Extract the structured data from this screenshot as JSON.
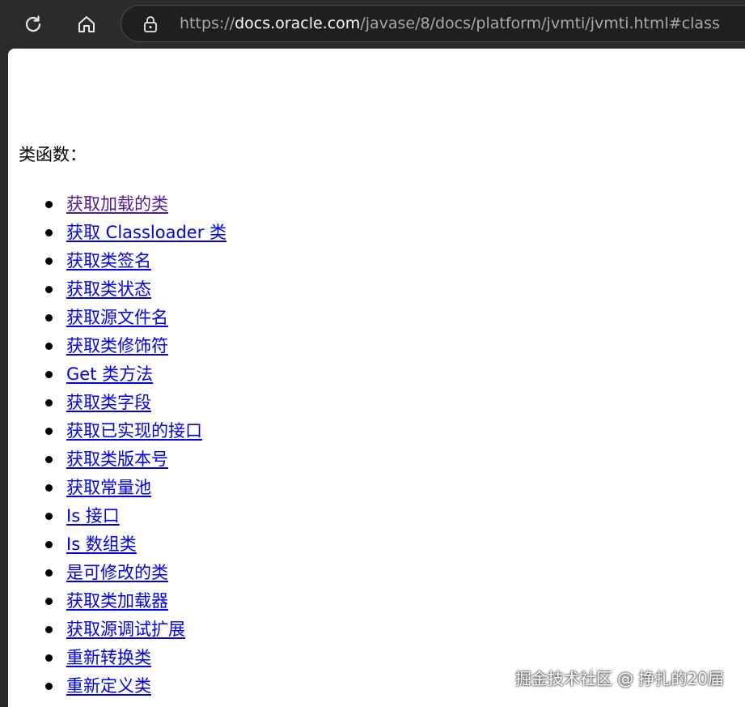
{
  "browser": {
    "url_scheme": "https://",
    "url_host": "docs.oracle.com",
    "url_path": "/javase/8/docs/platform/jvmti/jvmti.html#class"
  },
  "page": {
    "heading": "类函数：",
    "items": [
      {
        "label": "获取加载的类",
        "visited": true
      },
      {
        "label": "获取 Classloader 类",
        "visited": false
      },
      {
        "label": "获取类签名",
        "visited": false
      },
      {
        "label": "获取类状态",
        "visited": false
      },
      {
        "label": "获取源文件名",
        "visited": false
      },
      {
        "label": "获取类修饰符",
        "visited": false
      },
      {
        "label": "Get 类方法",
        "visited": false
      },
      {
        "label": "获取类字段",
        "visited": false
      },
      {
        "label": "获取已实现的接口",
        "visited": false
      },
      {
        "label": "获取类版本号",
        "visited": false
      },
      {
        "label": "获取常量池",
        "visited": false
      },
      {
        "label": "Is 接口",
        "visited": false
      },
      {
        "label": "Is 数组类",
        "visited": false
      },
      {
        "label": "是可修改的类",
        "visited": false
      },
      {
        "label": "获取类加载器",
        "visited": false
      },
      {
        "label": "获取源调试扩展",
        "visited": false
      },
      {
        "label": "重新转换类",
        "visited": false
      },
      {
        "label": "重新定义类",
        "visited": false
      }
    ]
  },
  "watermark": "掘金技术社区 @ 挣扎的20届",
  "colors": {
    "link": "#0000ee",
    "visited_link": "#551a8b",
    "chrome_bg": "#2b2b2b"
  },
  "icons": {
    "reload": "reload-icon",
    "home": "home-icon",
    "lock": "lock-icon"
  }
}
